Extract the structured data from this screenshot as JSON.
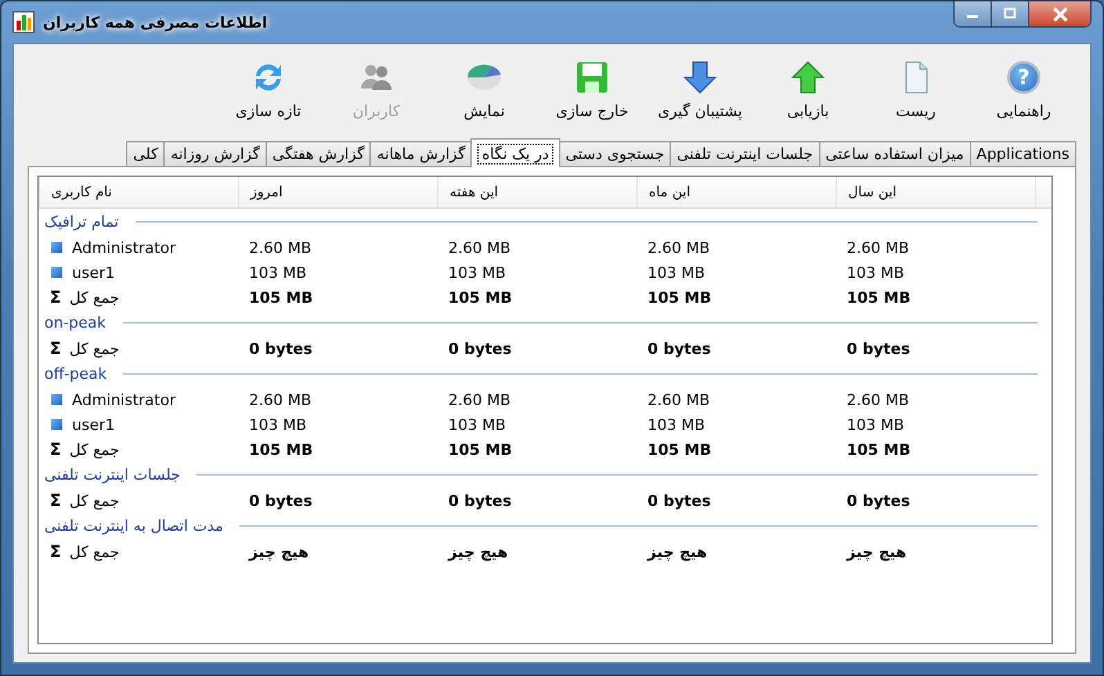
{
  "window": {
    "title": "اطلاعات مصرفی همه کاربران"
  },
  "toolbar": [
    {
      "label": "راهنمایی",
      "glyph": "?",
      "disabled": false
    },
    {
      "label": "ریست",
      "disabled": false
    },
    {
      "label": "بازیابی",
      "disabled": false
    },
    {
      "label": "پشتیبان گیری",
      "disabled": false
    },
    {
      "label": "خارج سازی",
      "disabled": false
    },
    {
      "label": "نمایش",
      "disabled": false
    },
    {
      "label": "کاربران",
      "disabled": true
    },
    {
      "label": "تازه سازی",
      "disabled": false
    }
  ],
  "tabs": [
    {
      "label": "Applications",
      "selected": false
    },
    {
      "label": "میزان استفاده ساعتی",
      "selected": false
    },
    {
      "label": "جلسات اینترنت تلفنی",
      "selected": false
    },
    {
      "label": "جستجوی دستی",
      "selected": false
    },
    {
      "label": "در یک نگاه",
      "selected": true
    },
    {
      "label": "گزارش ماهانه",
      "selected": false
    },
    {
      "label": "گزارش هفتگی",
      "selected": false
    },
    {
      "label": "گزارش روزانه",
      "selected": false
    },
    {
      "label": "کلی",
      "selected": false
    }
  ],
  "table": {
    "columns": [
      "این سال",
      "این ماه",
      "این هفته",
      "امروز",
      "نام کاربری"
    ],
    "groups": [
      {
        "title": "تمام ترافیک",
        "rows": [
          {
            "kind": "user",
            "values": [
              "2.60 MB",
              "2.60 MB",
              "2.60 MB",
              "2.60 MB"
            ],
            "name": "Administrator"
          },
          {
            "kind": "user",
            "values": [
              "103 MB",
              "103 MB",
              "103 MB",
              "103 MB"
            ],
            "name": "user1"
          },
          {
            "kind": "total",
            "values": [
              "105 MB",
              "105 MB",
              "105 MB",
              "105 MB"
            ],
            "name": "جمع کل",
            "symbol": "Σ"
          }
        ]
      },
      {
        "title": "on-peak",
        "rows": [
          {
            "kind": "total",
            "values": [
              "0 bytes",
              "0 bytes",
              "0 bytes",
              "0 bytes"
            ],
            "name": "جمع کل",
            "symbol": "Σ"
          }
        ]
      },
      {
        "title": "off-peak",
        "rows": [
          {
            "kind": "user",
            "values": [
              "2.60 MB",
              "2.60 MB",
              "2.60 MB",
              "2.60 MB"
            ],
            "name": "Administrator"
          },
          {
            "kind": "user",
            "values": [
              "103 MB",
              "103 MB",
              "103 MB",
              "103 MB"
            ],
            "name": "user1"
          },
          {
            "kind": "total",
            "values": [
              "105 MB",
              "105 MB",
              "105 MB",
              "105 MB"
            ],
            "name": "جمع کل",
            "symbol": "Σ"
          }
        ]
      },
      {
        "title": "جلسات اینترنت تلفنی",
        "rows": [
          {
            "kind": "total",
            "values": [
              "0 bytes",
              "0 bytes",
              "0 bytes",
              "0 bytes"
            ],
            "name": "جمع کل",
            "symbol": "Σ"
          }
        ]
      },
      {
        "title": "مدت اتصال به اینترنت تلفنی",
        "rows": [
          {
            "kind": "total",
            "values": [
              "هیچ چیز",
              "هیچ چیز",
              "هیچ چیز",
              "هیچ چیز"
            ],
            "name": "جمع کل",
            "symbol": "Σ"
          }
        ]
      }
    ]
  }
}
